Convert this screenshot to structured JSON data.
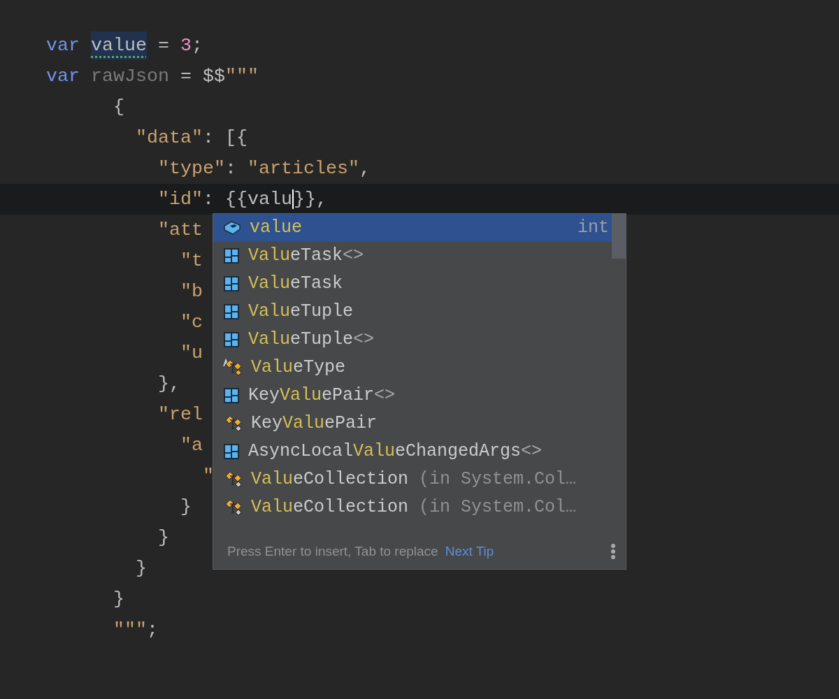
{
  "editor": {
    "lines": [
      {
        "current": false,
        "tokens": [
          {
            "kind": "keyword",
            "text": "var "
          },
          {
            "kind": "highlight",
            "text": "value"
          },
          {
            "kind": "plain",
            "text": " = "
          },
          {
            "kind": "number",
            "text": "3"
          },
          {
            "kind": "plain",
            "text": ";"
          }
        ]
      },
      {
        "current": false,
        "tokens": [
          {
            "kind": "keyword",
            "text": "var "
          },
          {
            "kind": "unused",
            "text": "rawJson"
          },
          {
            "kind": "plain",
            "text": " = $$"
          },
          {
            "kind": "string",
            "text": "\"\"\""
          }
        ]
      },
      {
        "current": false,
        "tokens": [
          {
            "kind": "plain",
            "text": "      {"
          }
        ]
      },
      {
        "current": false,
        "tokens": [
          {
            "kind": "string",
            "text": "        \"data\""
          },
          {
            "kind": "plain",
            "text": ": [{"
          }
        ]
      },
      {
        "current": false,
        "tokens": [
          {
            "kind": "string",
            "text": "          \"type\""
          },
          {
            "kind": "plain",
            "text": ": "
          },
          {
            "kind": "string",
            "text": "\"articles\""
          },
          {
            "kind": "plain",
            "text": ","
          }
        ]
      },
      {
        "current": true,
        "tokens": [
          {
            "kind": "string",
            "text": "          \"id\""
          },
          {
            "kind": "plain",
            "text": ": {{valu"
          },
          {
            "kind": "caret"
          },
          {
            "kind": "plain",
            "text": "}},"
          }
        ]
      },
      {
        "current": false,
        "tokens": [
          {
            "kind": "string",
            "text": "          \"att"
          }
        ]
      },
      {
        "current": false,
        "tokens": [
          {
            "kind": "string",
            "text": "            \"t"
          }
        ]
      },
      {
        "current": false,
        "tokens": [
          {
            "kind": "string",
            "text": "            \"b"
          }
        ]
      },
      {
        "current": false,
        "tokens": [
          {
            "kind": "string",
            "text": "            \"c"
          }
        ]
      },
      {
        "current": false,
        "tokens": [
          {
            "kind": "string",
            "text": "            \"u"
          }
        ]
      },
      {
        "current": false,
        "tokens": [
          {
            "kind": "plain",
            "text": "          },"
          }
        ]
      },
      {
        "current": false,
        "tokens": [
          {
            "kind": "string",
            "text": "          \"rel"
          }
        ]
      },
      {
        "current": false,
        "tokens": [
          {
            "kind": "string",
            "text": "            \"a"
          }
        ]
      },
      {
        "current": false,
        "tokens": [
          {
            "kind": "string",
            "text": "              \""
          }
        ]
      },
      {
        "current": false,
        "tokens": [
          {
            "kind": "plain",
            "text": "            }"
          }
        ]
      },
      {
        "current": false,
        "tokens": [
          {
            "kind": "plain",
            "text": "          }"
          }
        ]
      },
      {
        "current": false,
        "tokens": [
          {
            "kind": "plain",
            "text": "        }"
          }
        ]
      },
      {
        "current": false,
        "tokens": [
          {
            "kind": "plain",
            "text": "      }"
          }
        ]
      },
      {
        "current": false,
        "tokens": [
          {
            "kind": "string",
            "text": "      \"\"\""
          },
          {
            "kind": "plain",
            "text": ";"
          }
        ]
      }
    ]
  },
  "completion": {
    "items": [
      {
        "kind": "variable",
        "selected": true,
        "parts": [
          {
            "text": "value",
            "match": true
          }
        ],
        "type": "int"
      },
      {
        "kind": "class",
        "selected": false,
        "parts": [
          {
            "text": "Valu",
            "match": true
          },
          {
            "text": "eTask",
            "match": false
          }
        ],
        "suffix": "<>"
      },
      {
        "kind": "class",
        "selected": false,
        "parts": [
          {
            "text": "Valu",
            "match": true
          },
          {
            "text": "eTask",
            "match": false
          }
        ]
      },
      {
        "kind": "class",
        "selected": false,
        "parts": [
          {
            "text": "Valu",
            "match": true
          },
          {
            "text": "eTuple",
            "match": false
          }
        ]
      },
      {
        "kind": "class",
        "selected": false,
        "parts": [
          {
            "text": "Valu",
            "match": true
          },
          {
            "text": "eTuple",
            "match": false
          }
        ],
        "suffix": "<>"
      },
      {
        "kind": "type",
        "selected": false,
        "parts": [
          {
            "text": "Valu",
            "match": true
          },
          {
            "text": "eType",
            "match": false
          }
        ]
      },
      {
        "kind": "class",
        "selected": false,
        "parts": [
          {
            "text": "Key",
            "match": false
          },
          {
            "text": "Valu",
            "match": true
          },
          {
            "text": "ePair",
            "match": false
          }
        ],
        "suffix": "<>"
      },
      {
        "kind": "struct",
        "selected": false,
        "parts": [
          {
            "text": "Key",
            "match": false
          },
          {
            "text": "Valu",
            "match": true
          },
          {
            "text": "ePair",
            "match": false
          }
        ]
      },
      {
        "kind": "class",
        "selected": false,
        "parts": [
          {
            "text": "AsyncLocal",
            "match": false
          },
          {
            "text": "Valu",
            "match": true
          },
          {
            "text": "eChangedArgs",
            "match": false
          }
        ],
        "suffix": "<>"
      },
      {
        "kind": "struct",
        "selected": false,
        "parts": [
          {
            "text": "Valu",
            "match": true
          },
          {
            "text": "eCollection",
            "match": false
          }
        ],
        "location": " (in System.Col…"
      },
      {
        "kind": "struct",
        "selected": false,
        "parts": [
          {
            "text": "Valu",
            "match": true
          },
          {
            "text": "eCollection",
            "match": false
          }
        ],
        "location": " (in System.Col…"
      }
    ],
    "hint": "Press Enter to insert, Tab to replace",
    "link": "Next Tip"
  }
}
